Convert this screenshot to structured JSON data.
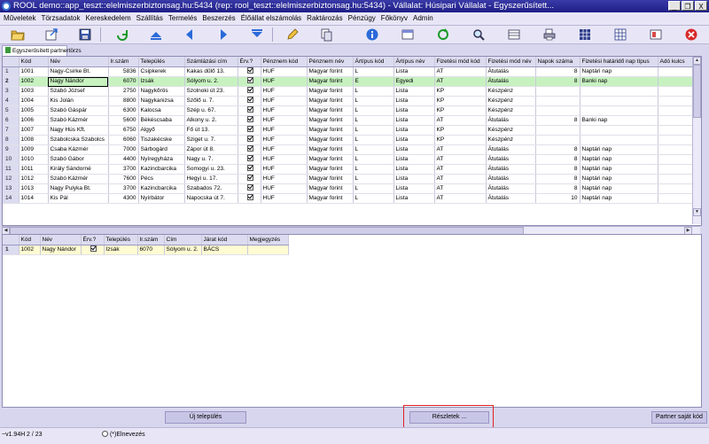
{
  "window": {
    "title": "ROOL demo::app_teszt::elelmiszerbiztonsag.hu:5434 (rep: rool_teszt::elelmiszerbiztonsag.hu:5434) - Vállalat: Húsipari Vállalat - Egyszerűsített...",
    "min": "_",
    "max": "❐",
    "close": "X"
  },
  "menu": [
    "Műveletek",
    "Törzsadatok",
    "Kereskedelem",
    "Szállítás",
    "Termelés",
    "Beszerzés",
    "Élőállat elszámolás",
    "Raktározás",
    "Pénzügy",
    "Főkönyv",
    "Admin"
  ],
  "toolbar": {
    "icons": [
      "folder-open-icon",
      "export-icon",
      "save-icon",
      "refresh-icon",
      "first-record-icon",
      "prev-record-icon",
      "next-record-icon",
      "last-record-icon",
      "edit-icon",
      "copy-icon",
      "info-icon",
      "window-icon",
      "reload-icon",
      "search-icon",
      "columns-icon",
      "print-icon",
      "grid-icon",
      "grid-settings-icon",
      "layout-icon",
      "cancel-icon"
    ]
  },
  "tab": {
    "label": "Egyszerűsített partnertörzs"
  },
  "main_grid": {
    "columns": [
      "Kód",
      "Név",
      "Ir.szám",
      "Település",
      "Számlázási cím",
      "Érv.?",
      "Pénznem kód",
      "Pénznem név",
      "Ártípus kód",
      "Ártípus név",
      "Fizetési mód kód",
      "Fizetési mód név",
      "Napok száma",
      "Fizetési határidő nap típus",
      "Adó kulcs"
    ],
    "rows": [
      {
        "n": "1",
        "kod": "1001",
        "nev": "Nagy-Csirke Bt.",
        "irsz": "5836",
        "telep": "Csipkerek",
        "cim": "Kakas dűlő 13.",
        "erv": true,
        "pnk": "HUF",
        "pnn": "Magyar forint",
        "atk": "L",
        "atn": "Lista",
        "fmk": "AT",
        "fmn": "Átutalás",
        "napok": "8",
        "fht": "Naptári nap"
      },
      {
        "n": "2",
        "kod": "1002",
        "nev": "Nagy Nándor",
        "irsz": "6070",
        "telep": "Izsák",
        "cim": "Sólyom u. 2.",
        "erv": true,
        "pnk": "HUF",
        "pnn": "Magyar forint",
        "atk": "E",
        "atn": "Egyedi",
        "fmk": "AT",
        "fmn": "Átutalás",
        "napok": "8",
        "fht": "Banki nap"
      },
      {
        "n": "3",
        "kod": "1003",
        "nev": "Szabó József",
        "irsz": "2750",
        "telep": "Nagykőrös",
        "cim": "Szolnoki út 23.",
        "erv": true,
        "pnk": "HUF",
        "pnn": "Magyar forint",
        "atk": "L",
        "atn": "Lista",
        "fmk": "KP",
        "fmn": "Készpénz",
        "napok": "",
        "fht": ""
      },
      {
        "n": "4",
        "kod": "1004",
        "nev": "Kis Jolán",
        "irsz": "8800",
        "telep": "Nagykanizsa",
        "cim": "Szőlő u. 7.",
        "erv": true,
        "pnk": "HUF",
        "pnn": "Magyar forint",
        "atk": "L",
        "atn": "Lista",
        "fmk": "KP",
        "fmn": "Készpénz",
        "napok": "",
        "fht": ""
      },
      {
        "n": "5",
        "kod": "1005",
        "nev": "Szabó Gáspár",
        "irsz": "6300",
        "telep": "Kalocsa",
        "cim": "Szép u. 67.",
        "erv": true,
        "pnk": "HUF",
        "pnn": "Magyar forint",
        "atk": "L",
        "atn": "Lista",
        "fmk": "KP",
        "fmn": "Készpénz",
        "napok": "",
        "fht": ""
      },
      {
        "n": "6",
        "kod": "1006",
        "nev": "Szabó Kázmér",
        "irsz": "5600",
        "telep": "Békéscsaba",
        "cim": "Alkony u. 2.",
        "erv": true,
        "pnk": "HUF",
        "pnn": "Magyar forint",
        "atk": "L",
        "atn": "Lista",
        "fmk": "AT",
        "fmn": "Átutalás",
        "napok": "8",
        "fht": "Banki nap"
      },
      {
        "n": "7",
        "kod": "1007",
        "nev": "Nagy Hús Kft.",
        "irsz": "6750",
        "telep": "Algyő",
        "cim": "Fő út 13.",
        "erv": true,
        "pnk": "HUF",
        "pnn": "Magyar forint",
        "atk": "L",
        "atn": "Lista",
        "fmk": "KP",
        "fmn": "Készpénz",
        "napok": "",
        "fht": ""
      },
      {
        "n": "8",
        "kod": "1008",
        "nev": "Szabolcska Szabolcs",
        "irsz": "6060",
        "telep": "Tiszakécske",
        "cim": "Sziget u. 7.",
        "erv": true,
        "pnk": "HUF",
        "pnn": "Magyar forint",
        "atk": "L",
        "atn": "Lista",
        "fmk": "KP",
        "fmn": "Készpénz",
        "napok": "",
        "fht": ""
      },
      {
        "n": "9",
        "kod": "1009",
        "nev": "Csaba Kázmér",
        "irsz": "7000",
        "telep": "Sárbogárd",
        "cim": "Zápor út 8.",
        "erv": true,
        "pnk": "HUF",
        "pnn": "Magyar forint",
        "atk": "L",
        "atn": "Lista",
        "fmk": "AT",
        "fmn": "Átutalás",
        "napok": "8",
        "fht": "Naptári nap"
      },
      {
        "n": "10",
        "kod": "1010",
        "nev": "Szabó Gábor",
        "irsz": "4400",
        "telep": "Nyíregyháza",
        "cim": "Nagy u. 7.",
        "erv": true,
        "pnk": "HUF",
        "pnn": "Magyar forint",
        "atk": "L",
        "atn": "Lista",
        "fmk": "AT",
        "fmn": "Átutalás",
        "napok": "8",
        "fht": "Naptári nap"
      },
      {
        "n": "11",
        "kod": "1011",
        "nev": "Király Sándorné",
        "irsz": "3700",
        "telep": "Kazincbarcika",
        "cim": "Somogyi u. 23.",
        "erv": true,
        "pnk": "HUF",
        "pnn": "Magyar forint",
        "atk": "L",
        "atn": "Lista",
        "fmk": "AT",
        "fmn": "Átutalás",
        "napok": "8",
        "fht": "Naptári nap"
      },
      {
        "n": "12",
        "kod": "1012",
        "nev": "Szabó Kázmér",
        "irsz": "7600",
        "telep": "Pécs",
        "cim": "Hegyi u. 17.",
        "erv": true,
        "pnk": "HUF",
        "pnn": "Magyar forint",
        "atk": "L",
        "atn": "Lista",
        "fmk": "AT",
        "fmn": "Átutalás",
        "napok": "8",
        "fht": "Naptári nap"
      },
      {
        "n": "13",
        "kod": "1013",
        "nev": "Nagy Pulyka Bt.",
        "irsz": "3700",
        "telep": "Kazincbarcika",
        "cim": "Szabados 72.",
        "erv": true,
        "pnk": "HUF",
        "pnn": "Magyar forint",
        "atk": "L",
        "atn": "Lista",
        "fmk": "AT",
        "fmn": "Átutalás",
        "napok": "8",
        "fht": "Naptári nap"
      },
      {
        "n": "14",
        "kod": "1014",
        "nev": "Kis Pál",
        "irsz": "4300",
        "telep": "Nyírbátor",
        "cim": "Napocska út 7.",
        "erv": true,
        "pnk": "HUF",
        "pnn": "Magyar forint",
        "atk": "L",
        "atn": "Lista",
        "fmk": "AT",
        "fmn": "Átutalás",
        "napok": "10",
        "fht": "Naptári nap"
      }
    ]
  },
  "detail_grid": {
    "columns": [
      "Kód",
      "Név",
      "Érv.?",
      "Település",
      "Ir.szám",
      "Cím",
      "Járat kód",
      "Megjegyzés"
    ],
    "rows": [
      {
        "n": "1",
        "kod": "1002",
        "nev": "Nagy Nándor",
        "erv": true,
        "telep": "Izsák",
        "irsz": "6070",
        "cim": "Sólyom u. 2.",
        "jarat": "BÁCS",
        "megj": ""
      }
    ]
  },
  "buttons": {
    "new_settlement": "Új település",
    "details": "Részletek ...",
    "partner_code": "Partner saját kód"
  },
  "status": {
    "version": "~v1.94H",
    "position": "2 / 23",
    "radio_label": "(*)Elnevezés"
  },
  "colors": {
    "selected_row": "#c7f2c0",
    "detail_row": "#fffbd2",
    "highlight_box": "#e02020",
    "titlebar": "#1e1e86"
  }
}
